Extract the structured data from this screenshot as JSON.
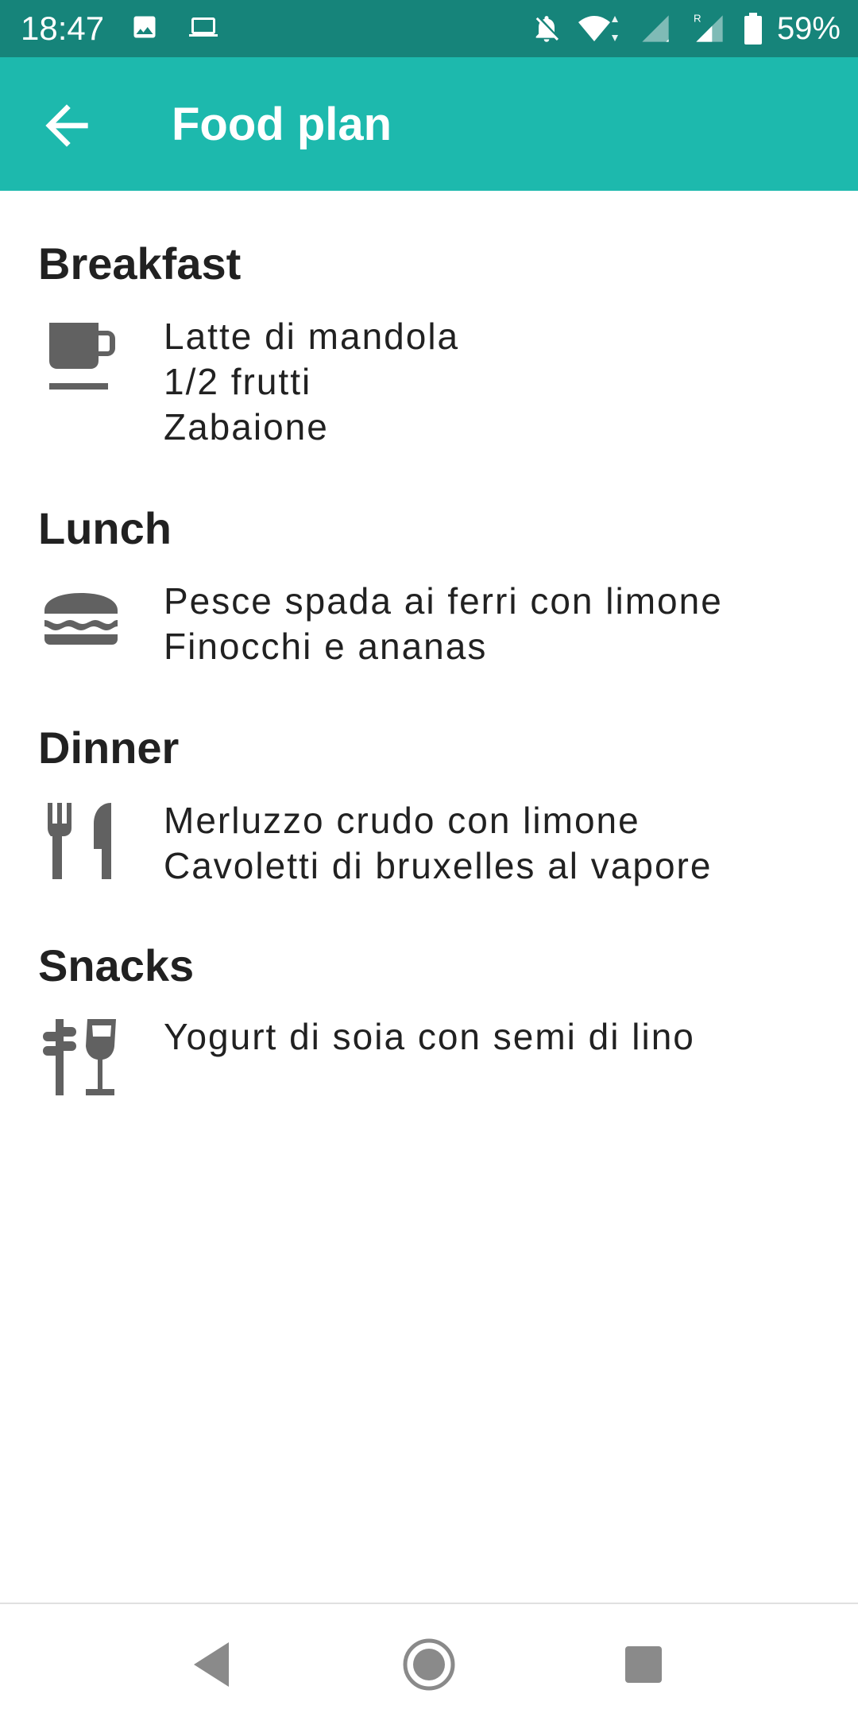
{
  "status_bar": {
    "time": "18:47",
    "battery": "59%",
    "icons": [
      "image-icon",
      "laptop-icon",
      "notifications-off-icon",
      "wifi-icon",
      "signal-icon",
      "roaming-signal-icon",
      "battery-icon"
    ]
  },
  "app_bar": {
    "title": "Food plan",
    "back_icon": "arrow-back-icon"
  },
  "meals": [
    {
      "title": "Breakfast",
      "icon": "coffee-cup-icon",
      "items": [
        "Latte di mandola",
        "1/2 frutti",
        "Zabaione"
      ]
    },
    {
      "title": "Lunch",
      "icon": "burger-icon",
      "items": [
        "Pesce spada ai ferri con limone",
        "Finocchi e ananas"
      ]
    },
    {
      "title": "Dinner",
      "icon": "fork-knife-icon",
      "items": [
        "Merluzzo crudo con limone",
        "Cavoletti di bruxelles al vapore"
      ]
    },
    {
      "title": "Snacks",
      "icon": "snack-drink-icon",
      "items": [
        "Yogurt di soia con semi di lino"
      ]
    }
  ],
  "nav_bar": {
    "icons": [
      "nav-back-icon",
      "nav-home-icon",
      "nav-recents-icon"
    ]
  },
  "colors": {
    "status_bar": "#16847a",
    "app_bar": "#1db9ad",
    "icon_grey": "#616161",
    "text": "#212121"
  }
}
